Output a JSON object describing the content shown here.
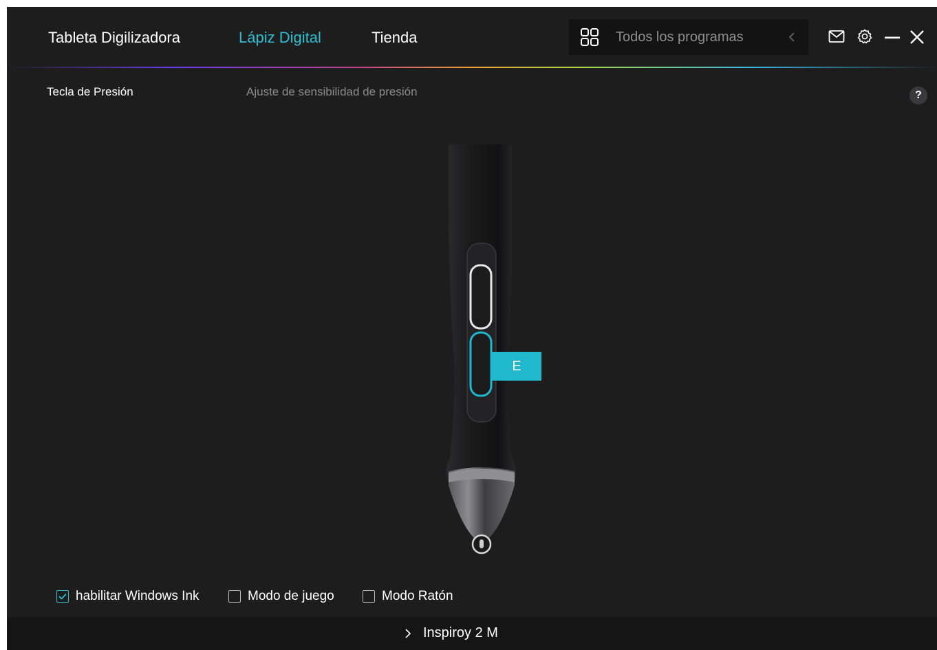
{
  "nav": {
    "tabs": [
      {
        "label": "Tableta Digilizadora",
        "active": false
      },
      {
        "label": "Lápiz Digital",
        "active": true
      },
      {
        "label": "Tienda",
        "active": false
      }
    ]
  },
  "program_selector": {
    "label": "Todos los programas",
    "icon": "grid-icon"
  },
  "window_controls": {
    "icons": [
      "mail-icon",
      "gear-icon",
      "minimize-icon",
      "close-icon"
    ]
  },
  "subheader": {
    "pressure_key": "Tecla de Presión",
    "sensitivity": "Ajuste de sensibilidad de presión",
    "help": "?"
  },
  "pen": {
    "lower_button_value": "E"
  },
  "options": [
    {
      "label": "habilitar Windows Ink",
      "checked": true
    },
    {
      "label": "Modo de juego",
      "checked": false
    },
    {
      "label": "Modo Ratón",
      "checked": false
    }
  ],
  "footer": {
    "device": "Inspiroy 2 M"
  },
  "colors": {
    "accent": "#2fbfd4",
    "background": "#1d1d1e",
    "footer": "#151516",
    "label_box": "#20b8cd"
  }
}
